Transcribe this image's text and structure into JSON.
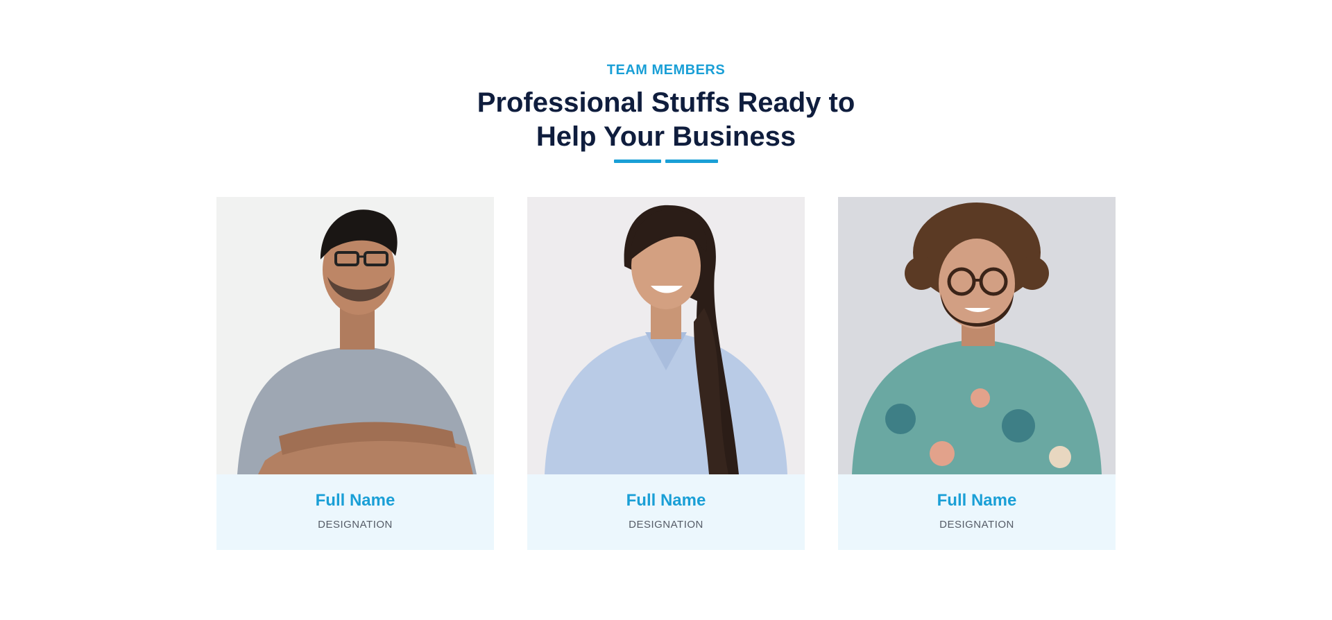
{
  "section": {
    "eyebrow": "TEAM MEMBERS",
    "title_line1": "Professional Stuffs Ready to",
    "title_line2": "Help Your Business"
  },
  "colors": {
    "accent": "#1a9fd6",
    "heading": "#0f1d3d",
    "card_info_bg": "#ecf7fd"
  },
  "members": [
    {
      "name": "Full Name",
      "designation": "DESIGNATION"
    },
    {
      "name": "Full Name",
      "designation": "DESIGNATION"
    },
    {
      "name": "Full Name",
      "designation": "DESIGNATION"
    }
  ]
}
